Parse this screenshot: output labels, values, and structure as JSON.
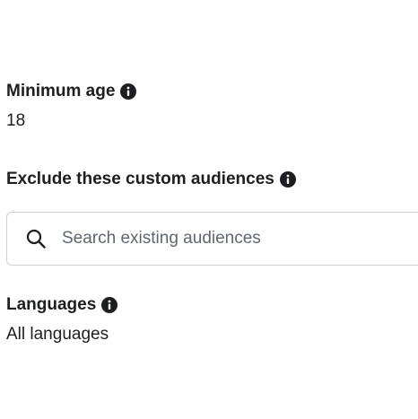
{
  "minimum_age": {
    "label": "Minimum age",
    "value": "18",
    "info_icon": "info-icon"
  },
  "exclude_audiences": {
    "label": "Exclude these custom audiences",
    "info_icon": "info-icon",
    "search": {
      "placeholder": "Search existing audiences",
      "value": "",
      "icon": "search-icon"
    }
  },
  "languages": {
    "label": "Languages",
    "value": "All languages",
    "info_icon": "info-icon"
  },
  "colors": {
    "text": "#1c1e21",
    "placeholder": "#606770",
    "border": "#ccd0d5",
    "icon": "#1c1e21"
  }
}
